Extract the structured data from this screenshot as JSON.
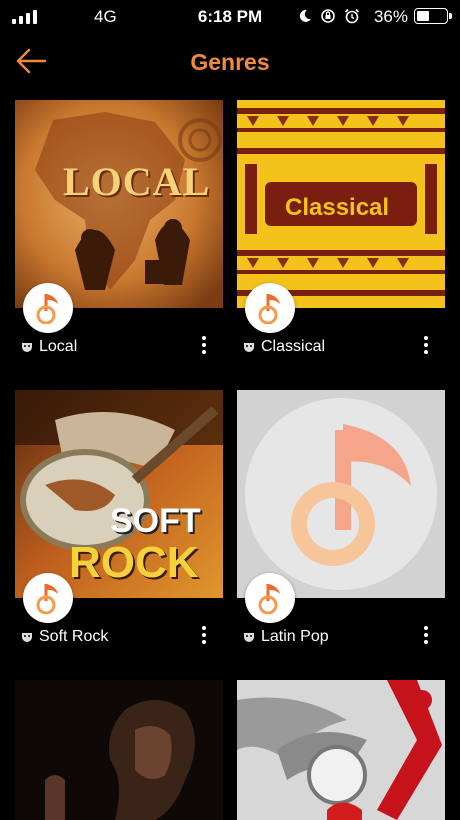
{
  "status_bar": {
    "network": "4G",
    "time": "6:18 PM",
    "battery_percent": "36%"
  },
  "header": {
    "title": "Genres"
  },
  "genres": [
    {
      "name": "Local",
      "art_text": "LOCAL"
    },
    {
      "name": "Classical",
      "art_text": "Classical"
    },
    {
      "name": "Soft Rock",
      "art_text_1": "SOFT",
      "art_text_2": "ROCK"
    },
    {
      "name": "Latin Pop"
    },
    {
      "name": ""
    },
    {
      "name": ""
    }
  ],
  "colors": {
    "accent": "#f08a3c",
    "background": "#000000"
  }
}
